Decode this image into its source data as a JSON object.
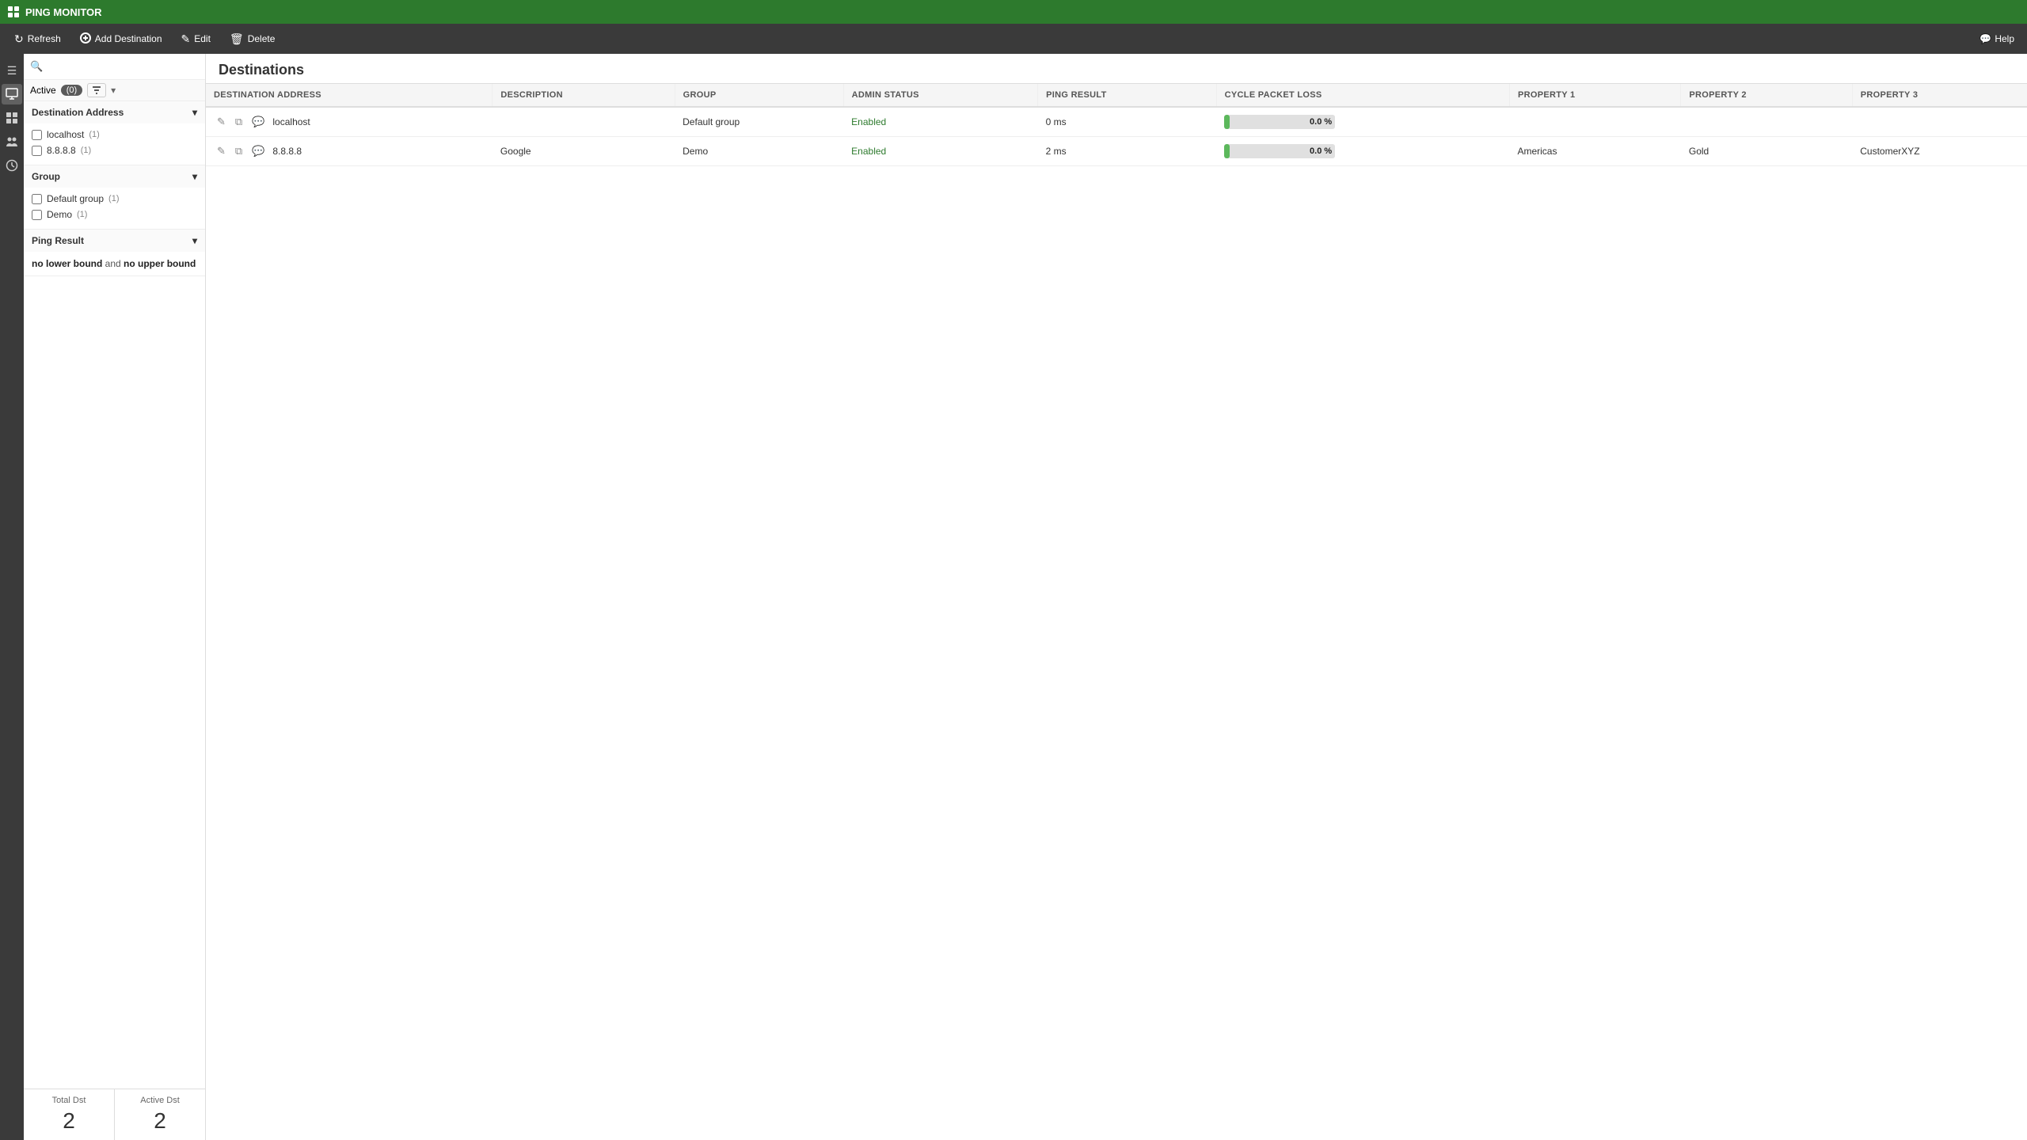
{
  "app": {
    "title": "PING MONITOR"
  },
  "toolbar": {
    "refresh_label": "Refresh",
    "add_destination_label": "Add Destination",
    "edit_label": "Edit",
    "delete_label": "Delete",
    "help_label": "Help"
  },
  "active_filter": {
    "label": "Active",
    "count": "(0)"
  },
  "filter": {
    "search_placeholder": "",
    "destination_address": {
      "title": "Destination Address",
      "items": [
        {
          "label": "localhost",
          "count": "(1)"
        },
        {
          "label": "8.8.8.8",
          "count": "(1)"
        }
      ]
    },
    "group": {
      "title": "Group",
      "items": [
        {
          "label": "Default group",
          "count": "(1)"
        },
        {
          "label": "Demo",
          "count": "(1)"
        }
      ]
    },
    "ping_result": {
      "title": "Ping Result",
      "lower_label": "no lower bound",
      "and_label": "and",
      "upper_label": "no upper bound"
    }
  },
  "stats": {
    "total_dst_label": "Total Dst",
    "total_dst_value": "2",
    "active_dst_label": "Active Dst",
    "active_dst_value": "2"
  },
  "content": {
    "title": "Destinations",
    "table": {
      "columns": [
        "DESTINATION ADDRESS",
        "DESCRIPTION",
        "GROUP",
        "ADMIN STATUS",
        "PING RESULT",
        "CYCLE PACKET LOSS",
        "PROPERTY 1",
        "PROPERTY 2",
        "PROPERTY 3"
      ],
      "rows": [
        {
          "destination_address": "localhost",
          "description": "",
          "group": "Default group",
          "admin_status": "Enabled",
          "ping_result": "0 ms",
          "cycle_packet_loss": 0,
          "cycle_packet_loss_label": "0.0 %",
          "property1": "",
          "property2": "",
          "property3": ""
        },
        {
          "destination_address": "8.8.8.8",
          "description": "Google",
          "group": "Demo",
          "admin_status": "Enabled",
          "ping_result": "2 ms",
          "cycle_packet_loss": 0,
          "cycle_packet_loss_label": "0.0 %",
          "property1": "Americas",
          "property2": "Gold",
          "property3": "CustomerXYZ"
        }
      ]
    }
  },
  "icons": {
    "grid": "⊞",
    "refresh": "↻",
    "add": "+",
    "edit": "✎",
    "delete": "🗑",
    "help": "?",
    "chevron_down": "▾",
    "chevron_right": "▸",
    "search": "🔍",
    "pencil": "✎",
    "copy": "⧉",
    "comment": "💬",
    "menu": "☰",
    "monitor": "🖥",
    "table": "⊞",
    "group": "👥",
    "clock": "⏱"
  }
}
